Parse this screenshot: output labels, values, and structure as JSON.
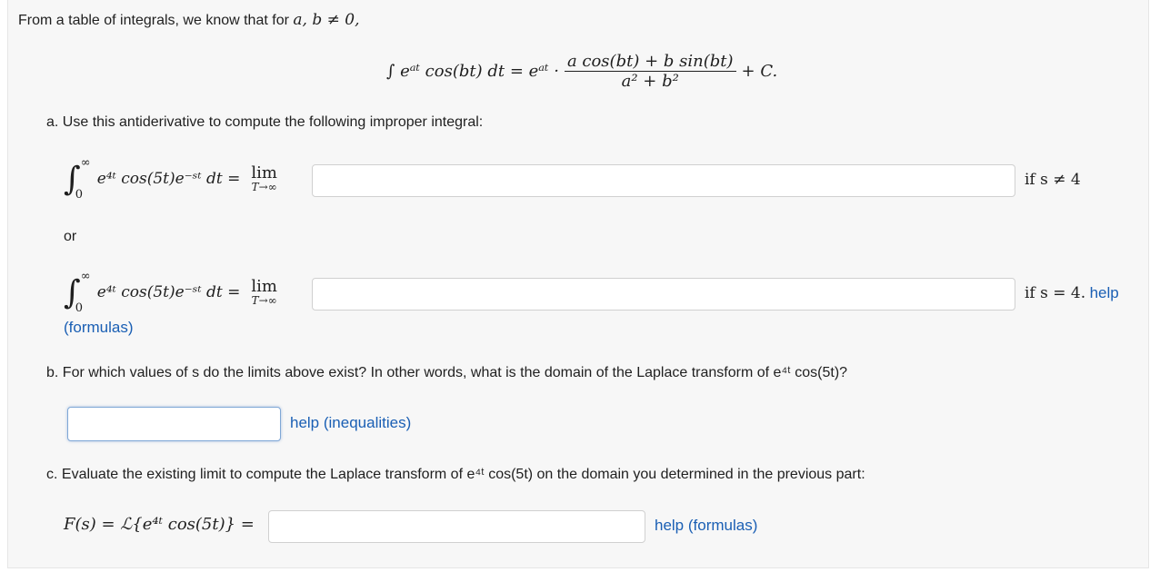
{
  "intro": {
    "text": "From a table of integrals, we know that for",
    "condition": "a, b ≠ 0,"
  },
  "formula": {
    "lhs": "∫ eᵃᵗ cos(bt) dt = eᵃᵗ ·",
    "numerator": "a cos(bt) + b sin(bt)",
    "denominator": "a² + b²",
    "tail": "+ C."
  },
  "part_a": {
    "prompt": "a. Use this antiderivative to compute the following improper integral:",
    "integral_expr": "e⁴ᵗ cos(5t)e⁻ˢᵗ dt  =",
    "lower": "0",
    "upper": "∞",
    "lim_word": "lim",
    "lim_sub": "T→∞",
    "row1": {
      "answer_value": "",
      "condition": "if s ≠ 4"
    },
    "or_label": "or",
    "row2": {
      "answer_value": "",
      "condition": "if s = 4."
    },
    "help_label": "help",
    "formulas_label": "(formulas)"
  },
  "part_b": {
    "prompt": "b. For which values of s do the limits above exist? In other words, what is the domain of the Laplace transform of e⁴ᵗ cos(5t)?",
    "answer_value": "",
    "help_label": "help (inequalities)"
  },
  "part_c": {
    "prompt": "c. Evaluate the existing limit to compute the Laplace transform of e⁴ᵗ cos(5t) on the domain you determined in the previous part:",
    "lhs": "F(s) = ℒ{e⁴ᵗ cos(5t)} =",
    "answer_value": "",
    "help_label": "help (formulas)"
  },
  "colors": {
    "link": "#1a5fb4",
    "panel": "#f7f7f7",
    "focus": "#7fa7d6"
  }
}
